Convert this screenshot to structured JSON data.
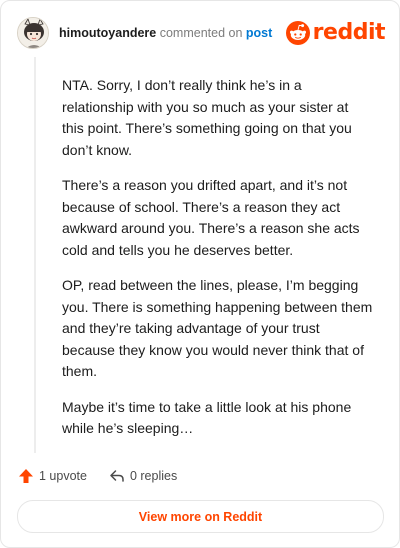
{
  "header": {
    "author": "himoutoyandere",
    "action_text": "commented on",
    "post_link": "post",
    "brand_name": "reddit",
    "brand_color": "#ff4500",
    "link_color": "#0079d3",
    "avatar_icon": "user-avatar"
  },
  "comment": {
    "paragraphs": [
      "NTA. Sorry, I don’t really think he’s in a relationship with you so much as your sister at this point. There’s something going on that you don’t know.",
      "There’s a reason you drifted apart, and it’s not because of school. There’s a reason they act awkward around you. There’s a reason she acts cold and tells you he deserves better.",
      "OP, read between the lines, please, I’m begging you. There is something happening between them and they’re taking advantage of your trust because they know you would never think that of them.",
      "Maybe it’s time to take a little look at his phone while he’s sleeping…"
    ]
  },
  "footer": {
    "upvotes": "1 upvote",
    "upvote_icon": "upvote-arrow-icon",
    "replies": "0 replies",
    "reply_icon": "reply-arrow-icon",
    "view_more": "View more on Reddit"
  }
}
